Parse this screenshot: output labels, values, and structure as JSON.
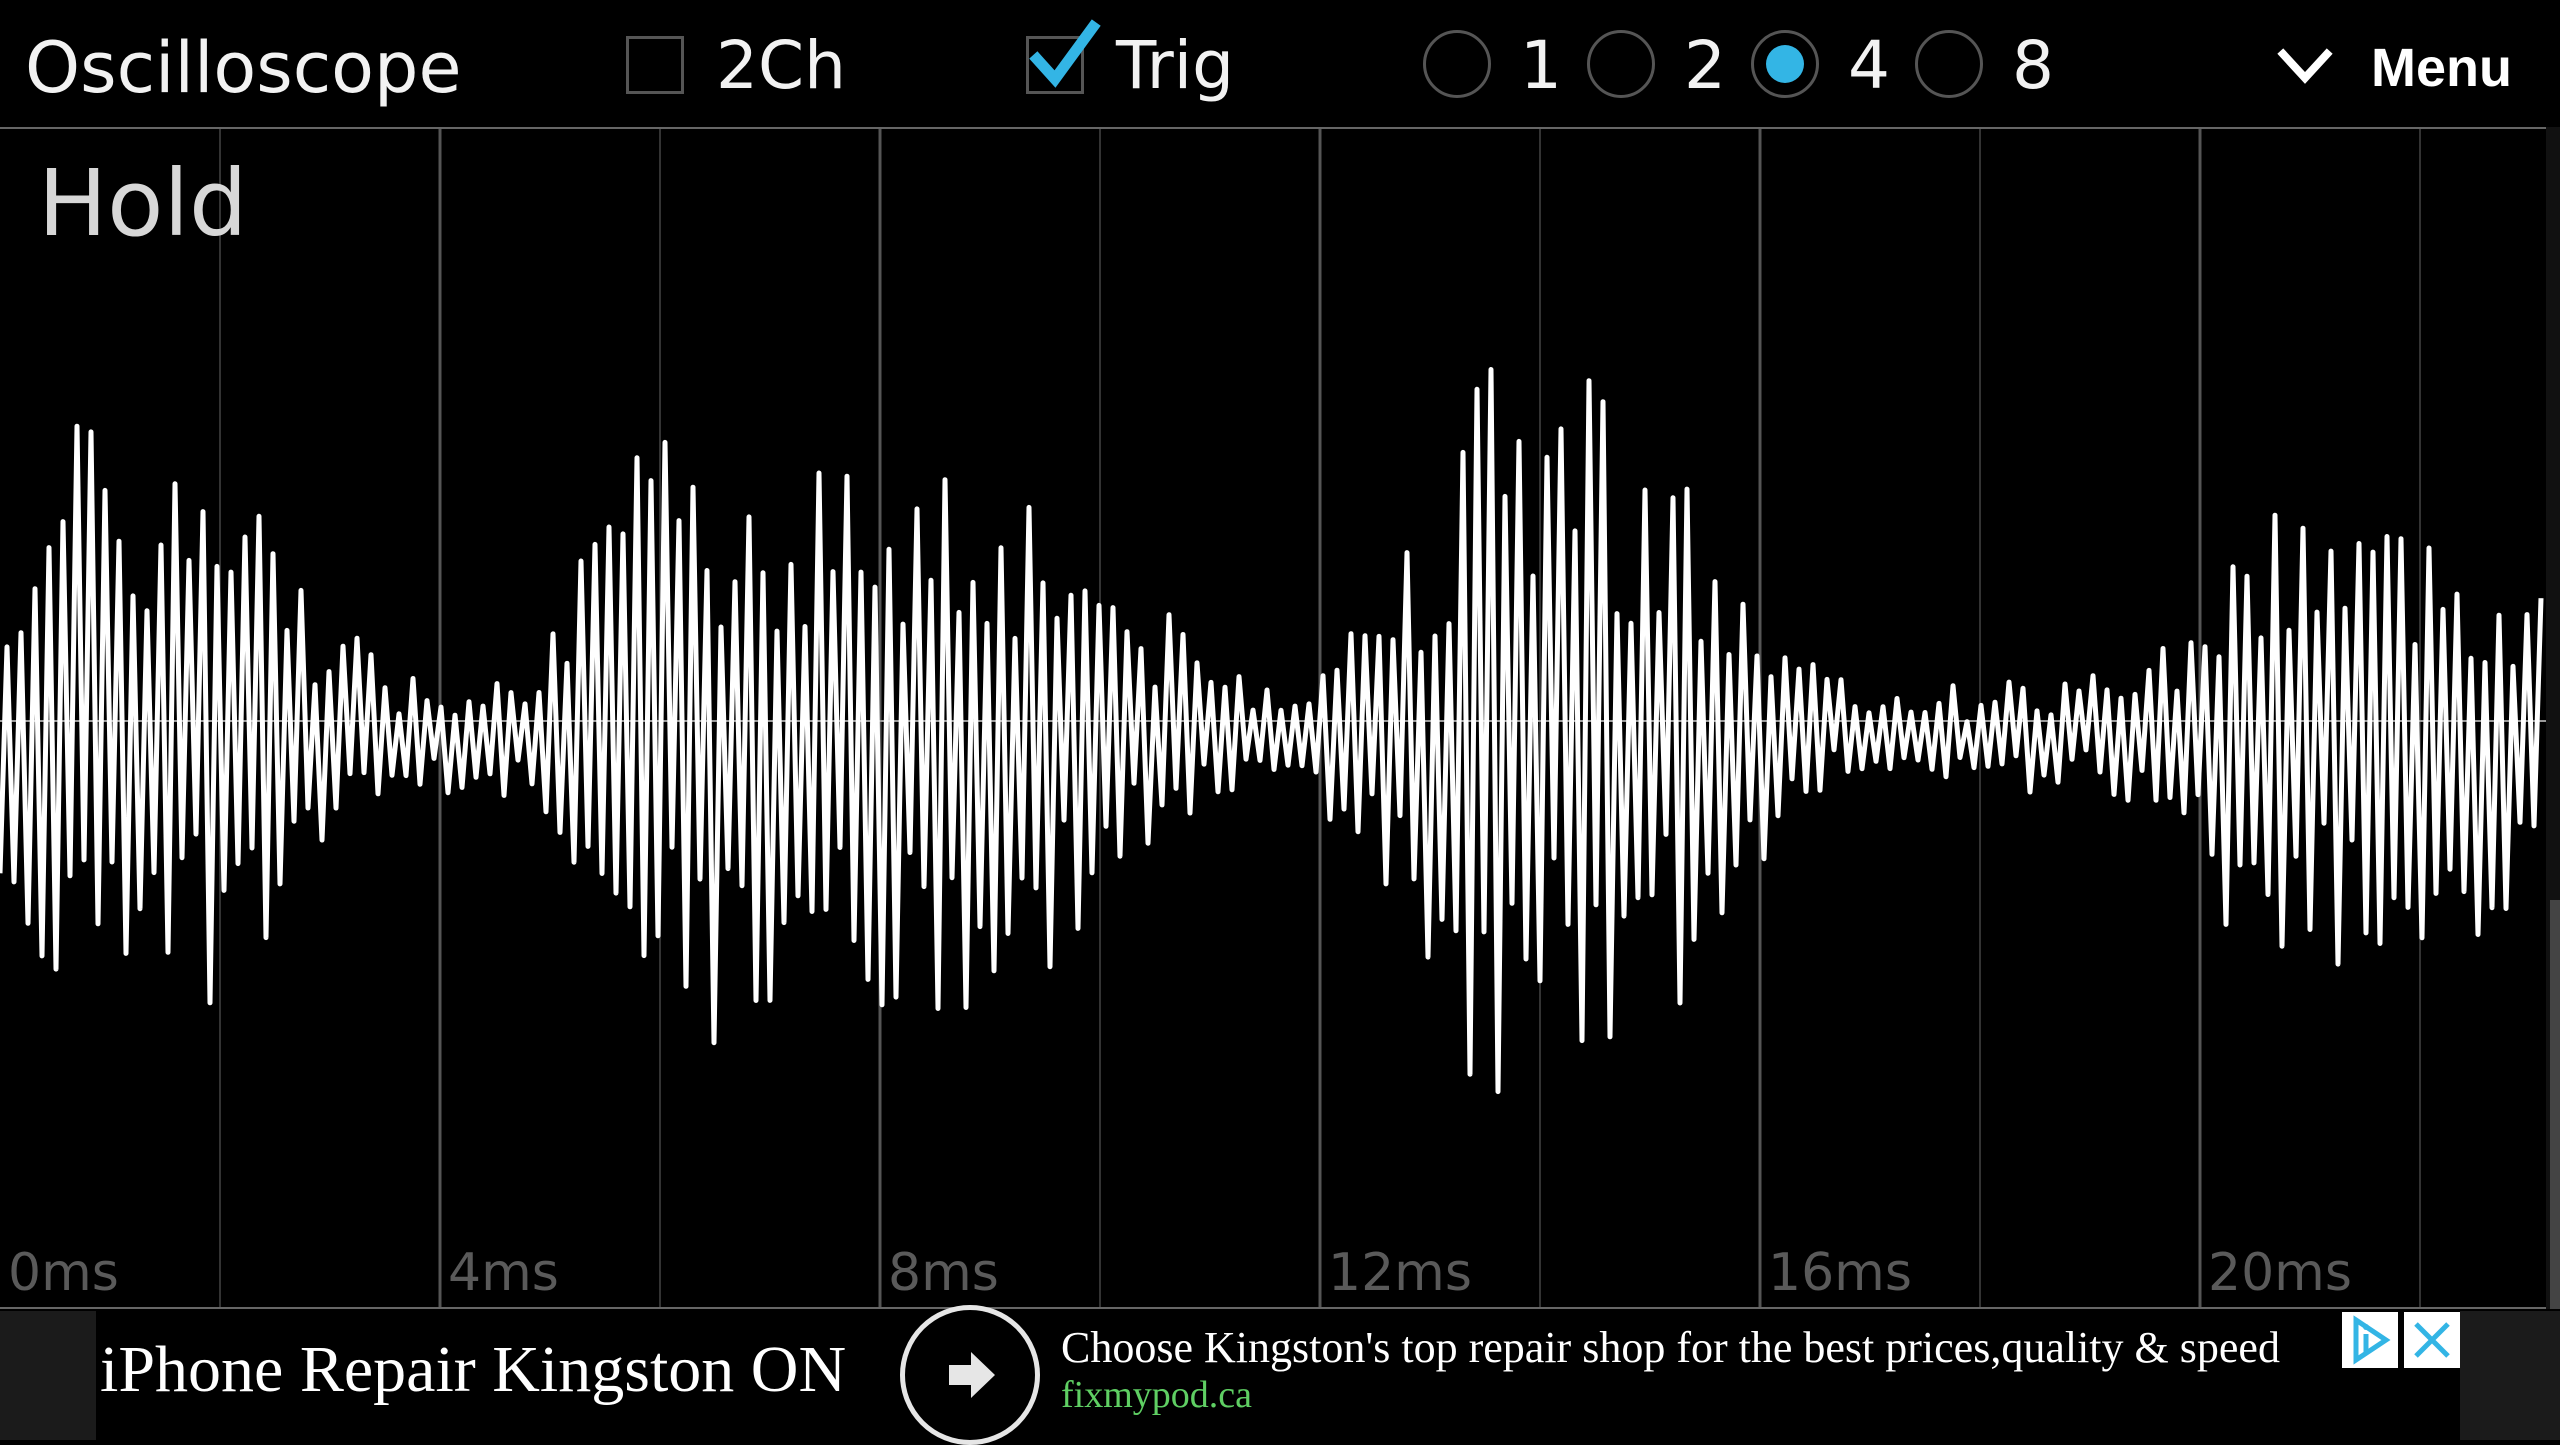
{
  "app": {
    "title": "Oscilloscope"
  },
  "controls": {
    "two_channel": {
      "label": "2Ch",
      "checked": false
    },
    "trigger": {
      "label": "Trig",
      "checked": true
    },
    "scale_options": [
      "1",
      "2",
      "4",
      "8"
    ],
    "scale_selected": "4",
    "menu_label": "Menu"
  },
  "scope": {
    "status": "Hold",
    "time_ticks": [
      "0ms",
      "4ms",
      "8ms",
      "12ms",
      "16ms",
      "20ms"
    ],
    "accent_color": "#33b5e5",
    "trace_color": "#ffffff"
  },
  "ad": {
    "title": "iPhone Repair Kingston ON",
    "description": "Choose Kingston's top repair shop for the best prices,quality & speed",
    "url": "fixmypod.ca"
  }
}
